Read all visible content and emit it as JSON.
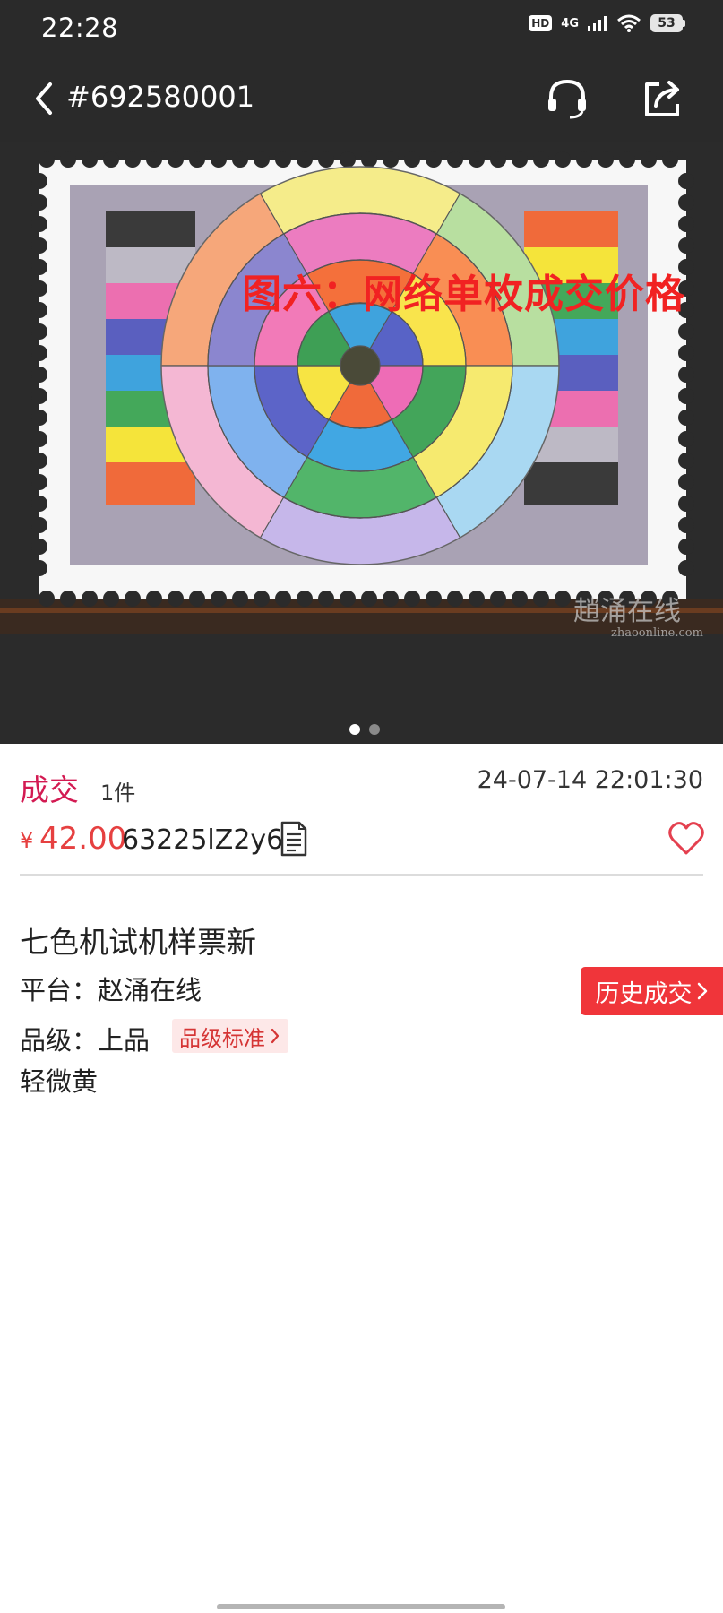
{
  "status_bar": {
    "time": "22:28",
    "hd_label": "HD",
    "network_label": "4G",
    "battery_level": "53"
  },
  "nav": {
    "item_id": "#692580001",
    "icons": {
      "back": "chevron-left-icon",
      "support": "headset-icon",
      "share": "share-icon"
    }
  },
  "hero": {
    "caption": "图六：网络单枚成交价格",
    "watermark": "趙涌在线 zhaoonline.com",
    "carousel_pages": 2,
    "carousel_active": 1
  },
  "deal": {
    "status": "成交",
    "count": "1件",
    "time": "24-07-14 22:01:30",
    "currency": "¥",
    "price": "42.00",
    "code": "63225lZ2y6"
  },
  "item": {
    "title": "七色机试机样票新",
    "platform": "平台：赵涌在线",
    "grade": "品级：上品",
    "grade_standard": "品级标准",
    "condition": "轻微黄"
  },
  "actions": {
    "history": "历史成交"
  },
  "colors": {
    "accent_red": "#f0353a",
    "status_crimson": "#d31a52",
    "price_red": "#e64040",
    "caption_red": "#f12222",
    "top_bar": "#2a2a2a"
  }
}
